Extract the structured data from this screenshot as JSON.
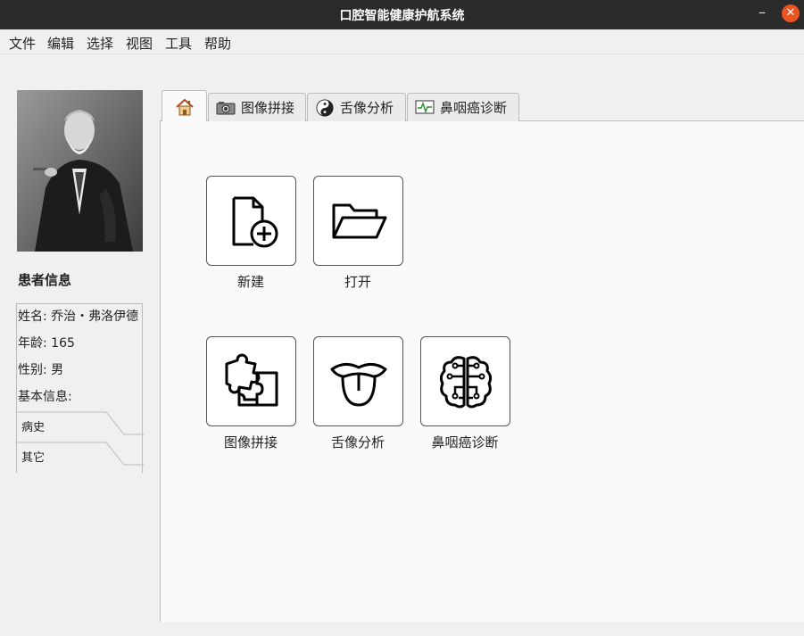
{
  "window": {
    "title": "口腔智能健康护航系统",
    "minimize": "–",
    "close": "✕"
  },
  "menu": [
    "文件",
    "编辑",
    "选择",
    "视图",
    "工具",
    "帮助"
  ],
  "patient": {
    "section_title": "患者信息",
    "name": "姓名: 乔治・弗洛伊德",
    "age": "年龄: 165",
    "gender": "性别: 男",
    "basic": "基本信息:",
    "subtabs": [
      "病史",
      "其它"
    ]
  },
  "tabs": [
    {
      "label": "",
      "icon": "home-icon"
    },
    {
      "label": "图像拼接",
      "icon": "camera-icon"
    },
    {
      "label": "舌像分析",
      "icon": "yin-yang-icon"
    },
    {
      "label": "鼻咽癌诊断",
      "icon": "monitor-icon"
    }
  ],
  "tiles": [
    {
      "label": "新建",
      "icon": "new-file-icon"
    },
    {
      "label": "打开",
      "icon": "open-folder-icon"
    },
    {
      "label": "图像拼接",
      "icon": "puzzle-icon"
    },
    {
      "label": "舌像分析",
      "icon": "tongue-icon"
    },
    {
      "label": "鼻咽癌诊断",
      "icon": "brain-circuit-icon"
    }
  ]
}
